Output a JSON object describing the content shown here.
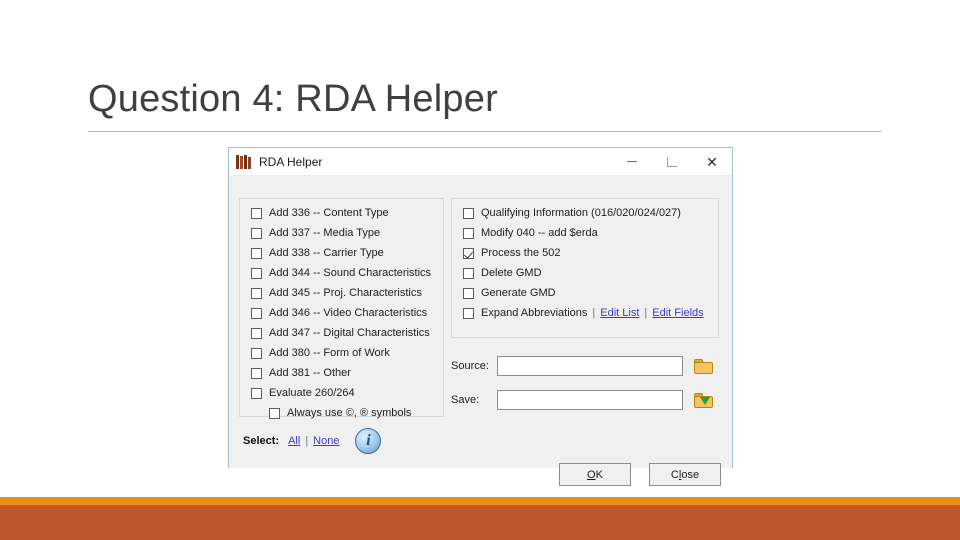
{
  "slide": {
    "title": "Question 4: RDA Helper"
  },
  "window": {
    "title": "RDA Helper",
    "icon": "books-icon",
    "controls": {
      "minimize": "–",
      "maximize": "maximize-glyph",
      "close": "✕"
    }
  },
  "left_panel": {
    "items": [
      {
        "label": "Add 336 -- Content Type",
        "checked": false,
        "indent": false
      },
      {
        "label": "Add 337 -- Media Type",
        "checked": false,
        "indent": false
      },
      {
        "label": "Add 338 -- Carrier Type",
        "checked": false,
        "indent": false
      },
      {
        "label": "Add 344 -- Sound Characteristics",
        "checked": false,
        "indent": false
      },
      {
        "label": "Add 345 -- Proj. Characteristics",
        "checked": false,
        "indent": false
      },
      {
        "label": "Add 346 -- Video Characteristics",
        "checked": false,
        "indent": false
      },
      {
        "label": "Add 347 -- Digital Characteristics",
        "checked": false,
        "indent": false
      },
      {
        "label": "Add 380 -- Form of Work",
        "checked": false,
        "indent": false
      },
      {
        "label": "Add 381 -- Other",
        "checked": false,
        "indent": false
      },
      {
        "label": "Evaluate 260/264",
        "checked": false,
        "indent": false
      },
      {
        "label": "Always use ©, ® symbols",
        "checked": false,
        "indent": true
      }
    ]
  },
  "right_panel": {
    "items": [
      {
        "label": "Qualifying Information (016/020/024/027)",
        "checked": false
      },
      {
        "label": "Modify 040 -- add $erda",
        "checked": false
      },
      {
        "label": "Process the 502",
        "checked": true
      },
      {
        "label": "Delete GMD",
        "checked": false
      },
      {
        "label": "Generate GMD",
        "checked": false
      },
      {
        "label": "Expand Abbreviations",
        "checked": false
      }
    ],
    "expand_links": {
      "pipe_before": "|",
      "edit_list": "Edit List",
      "pipe_between": "|",
      "edit_fields": "Edit Fields"
    }
  },
  "fields": {
    "source": {
      "label": "Source:",
      "value": "",
      "browse_icon": "folder-open-icon"
    },
    "save": {
      "label": "Save:",
      "value": "",
      "browse_icon": "folder-save-icon"
    }
  },
  "select_row": {
    "label": "Select:",
    "all": "All",
    "separator": "|",
    "none": "None",
    "info_glyph": "i"
  },
  "buttons": {
    "ok": {
      "accel": "O",
      "rest": "K"
    },
    "close": {
      "first": "C",
      "accel": "l",
      "rest": "ose"
    }
  },
  "colors": {
    "accent_orange_thin": "#e8901a",
    "accent_orange_thick": "#c0562b",
    "link_blue": "#3b3bc4",
    "title_gray": "#404040"
  }
}
